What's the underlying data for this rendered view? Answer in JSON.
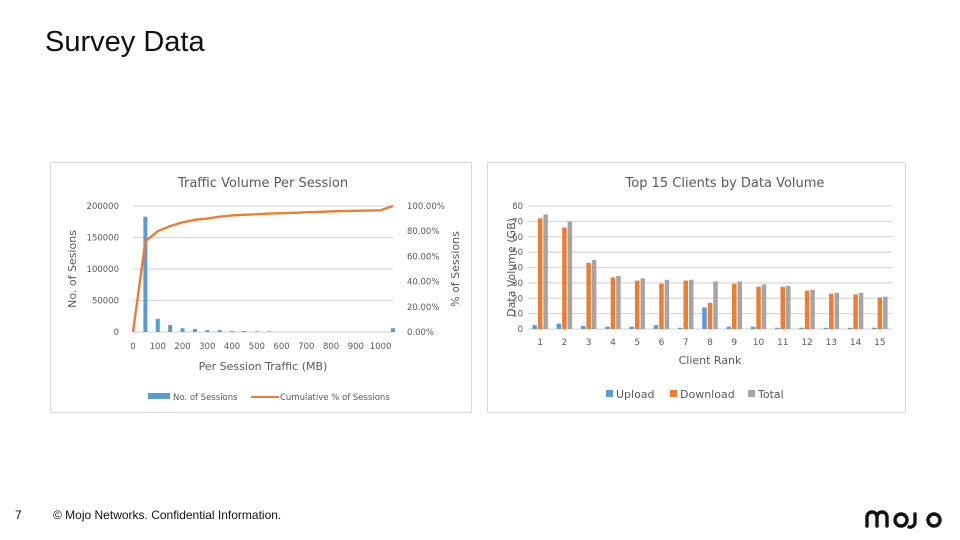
{
  "slide": {
    "title": "Survey Data",
    "page_number": "7",
    "footer": "© Mojo Networks. Confidential Information.",
    "logo_text": "mojo"
  },
  "chart_data": [
    {
      "type": "bar+line",
      "title": "Traffic Volume Per Session",
      "xlabel": "Per Session Traffic (MB)",
      "ylabel": "No. of Sesions",
      "y2label": "% of Sessions",
      "x_ticks": [
        "0",
        "100",
        "200",
        "300",
        "400",
        "500",
        "600",
        "700",
        "800",
        "900",
        "1000"
      ],
      "y_ticks": [
        "0",
        "50000",
        "100000",
        "150000",
        "200000"
      ],
      "y2_ticks": [
        "0.00%",
        "20.00%",
        "40.00%",
        "60.00%",
        "80.00%",
        "100.00%"
      ],
      "xlim": [
        0,
        1050
      ],
      "ylim": [
        0,
        200000
      ],
      "y2lim": [
        0,
        100
      ],
      "grid": true,
      "legend_position": "bottom",
      "colors": {
        "bars": "#5b9bd5",
        "line": "#ed7d31"
      },
      "series": [
        {
          "name": "No. of Sessions",
          "kind": "bar",
          "x": [
            50,
            100,
            150,
            200,
            250,
            300,
            350,
            400,
            450,
            500,
            550,
            1050
          ],
          "values": [
            183000,
            21000,
            11000,
            6000,
            5000,
            3000,
            3000,
            1500,
            1500,
            1000,
            1000,
            6000
          ]
        },
        {
          "name": "Cumulative % of Sessions",
          "kind": "line",
          "x": [
            0,
            50,
            100,
            150,
            200,
            250,
            300,
            350,
            400,
            450,
            500,
            550,
            600,
            650,
            700,
            750,
            800,
            850,
            900,
            950,
            1000,
            1050
          ],
          "values": [
            0,
            72,
            80,
            84,
            87,
            89,
            90,
            91.5,
            92.5,
            93,
            93.5,
            94,
            94.3,
            94.6,
            95,
            95.3,
            95.7,
            96,
            96.2,
            96.4,
            96.6,
            100
          ]
        }
      ]
    },
    {
      "type": "bar",
      "title": "Top 15 Clients by Data Volume",
      "xlabel": "Client Rank",
      "ylabel": "Data Volume (GB)",
      "categories": [
        "1",
        "2",
        "3",
        "4",
        "5",
        "6",
        "7",
        "8",
        "9",
        "10",
        "11",
        "12",
        "13",
        "14",
        "15"
      ],
      "y_ticks": [
        "0",
        "10",
        "20",
        "30",
        "40",
        "50",
        "60",
        "70",
        "80"
      ],
      "ylim": [
        0,
        80
      ],
      "grid": true,
      "legend_position": "bottom",
      "series": [
        {
          "name": "Upload",
          "color": "#5b9bd5",
          "values": [
            2.5,
            3.5,
            2,
            1.5,
            1.5,
            2.5,
            0.8,
            14,
            1.5,
            1.5,
            0.8,
            0.8,
            0.8,
            0.8,
            0.8
          ]
        },
        {
          "name": "Download",
          "color": "#ed7d31",
          "values": [
            72,
            66,
            43,
            33.5,
            31.5,
            29.5,
            31.5,
            17,
            29.5,
            27.5,
            27.5,
            25,
            23,
            22.5,
            20.5
          ]
        },
        {
          "name": "Total",
          "color": "#a5a5a5",
          "values": [
            74.5,
            70,
            45,
            34.5,
            33,
            32,
            32,
            31,
            31,
            29,
            28,
            25.5,
            23.5,
            23.5,
            21
          ]
        }
      ]
    }
  ]
}
